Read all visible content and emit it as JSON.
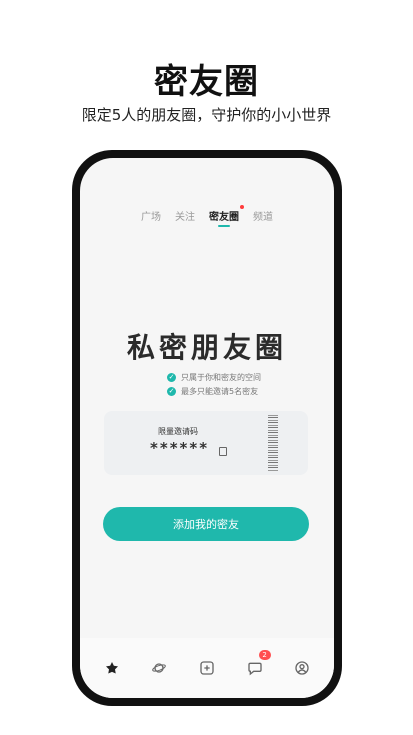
{
  "hero": {
    "title": "密友圈",
    "subtitle": "限定5人的朋友圈，守护你的小小世界"
  },
  "tabs": [
    {
      "label": "广场"
    },
    {
      "label": "关注"
    },
    {
      "label": "密友圈",
      "active": true
    },
    {
      "label": "频道"
    }
  ],
  "main": {
    "title": "私密朋友圈",
    "features": [
      "只属于你和密友的空间",
      "最多只能邀请5名密友"
    ],
    "ticket": {
      "label": "限量邀请码",
      "code": "******"
    },
    "add_button": "添加我的密友"
  },
  "bottom_nav": {
    "items": [
      {
        "icon": "star-icon"
      },
      {
        "icon": "planet-icon"
      },
      {
        "icon": "plus-square-icon"
      },
      {
        "icon": "chat-icon",
        "badge": "2"
      },
      {
        "icon": "user-icon"
      }
    ]
  },
  "colors": {
    "accent": "#1fb8ac",
    "badge": "#ff4d4f"
  }
}
